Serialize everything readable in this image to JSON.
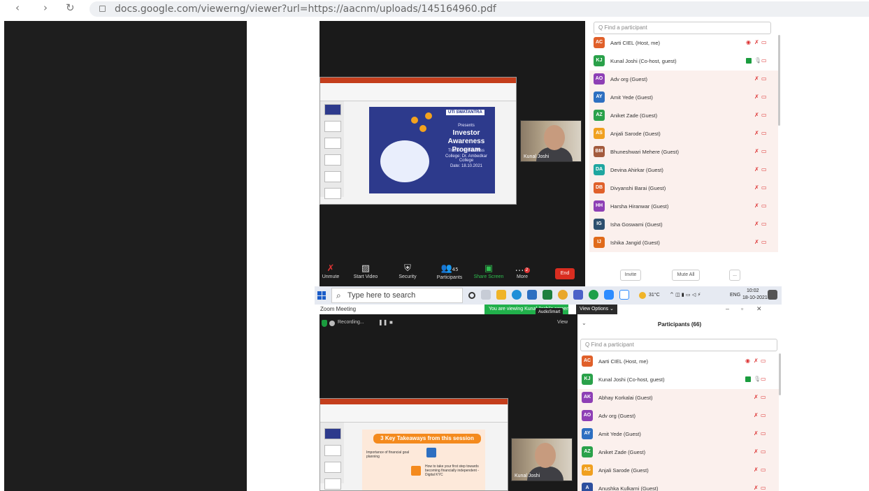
{
  "browser": {
    "url": "docs.google.com/viewerng/viewer?url=https://aacnm/uploads/145164960.pdf",
    "back_glyph": "‹",
    "forward_glyph": "›",
    "reload_glyph": "↻"
  },
  "meeting_top": {
    "slide": {
      "logo": "UTI SWATANTRA",
      "presents": "Presents",
      "title": "Investor Awareness Program",
      "trainer": "Trainer: by Ms/Miss",
      "college": "College: Dr. Ambedkar College",
      "date": "Date: 18.10.2021"
    },
    "camera_label": "Kunal Joshi"
  },
  "toolbar": {
    "unmute": "Unmute",
    "start_video": "Start Video",
    "security": "Security",
    "participants": "Participants",
    "participants_count": "45",
    "share_screen": "Share Screen",
    "more": "More",
    "end": "End",
    "more_badge": "2"
  },
  "participants_top": {
    "search_placeholder": "Find a participant",
    "items": [
      {
        "initials": "AC",
        "name": "Aarti CIEL (Host, me)",
        "color": "#e0602a"
      },
      {
        "initials": "KJ",
        "name": "Kunal Joshi (Co-host, guest)",
        "color": "#2aa14a"
      },
      {
        "initials": "AO",
        "name": "Adv org (Guest)",
        "color": "#8e3fb5"
      },
      {
        "initials": "AY",
        "name": "Amit Yede (Guest)",
        "color": "#2d6fc1"
      },
      {
        "initials": "AZ",
        "name": "Aniket Zade (Guest)",
        "color": "#2aa14a"
      },
      {
        "initials": "AS",
        "name": "Anjali Sarode (Guest)",
        "color": "#f0a020"
      },
      {
        "initials": "BM",
        "name": "Bhuneshwari Mehere (Guest)",
        "color": "#a35a3d"
      },
      {
        "initials": "DA",
        "name": "Devina Ahirkar (Guest)",
        "color": "#1fa6a0"
      },
      {
        "initials": "DB",
        "name": "Divyanshi Barai (Guest)",
        "color": "#e0602a"
      },
      {
        "initials": "HH",
        "name": "Harsha Hiranwar (Guest)",
        "color": "#8e3fb5"
      },
      {
        "initials": "IG",
        "name": "Isha Goswami (Guest)",
        "color": "#2d4f6e"
      },
      {
        "initials": "IJ",
        "name": "Ishika Jangid (Guest)",
        "color": "#e06a1a"
      }
    ],
    "invite": "Invite",
    "mute_all": "Mute All",
    "more": "..."
  },
  "taskbar": {
    "search_placeholder": "Type here to search",
    "temperature": "31°C",
    "language": "ENG",
    "time": "10:02",
    "date": "18-10-2021"
  },
  "meeting_bottom": {
    "window_title": "Zoom Meeting",
    "banner": "You are viewing Kunal Joshi's screen",
    "tooltip": "AudioSmart",
    "view_options": "View Options ⌄",
    "recording": "Recording...",
    "view": "View",
    "participants_header": "Participants (66)",
    "slide": {
      "heading": "3 Key Takeaways from this session",
      "point1": "Importance of financial goal planning",
      "point2": "How to take your first step towards becoming financially independent - Digital KYC"
    },
    "camera_label": "Kunal Joshi"
  },
  "participants_bottom": {
    "search_placeholder": "Find a participant",
    "items": [
      {
        "initials": "AC",
        "name": "Aarti CIEL (Host, me)",
        "color": "#e0602a"
      },
      {
        "initials": "KJ",
        "name": "Kunal Joshi (Co-host, guest)",
        "color": "#2aa14a"
      },
      {
        "initials": "AK",
        "name": "Abhay Korkalai (Guest)",
        "color": "#8e3fb5"
      },
      {
        "initials": "AO",
        "name": "Adv org (Guest)",
        "color": "#8e3fb5"
      },
      {
        "initials": "AY",
        "name": "Amit Yede (Guest)",
        "color": "#2d6fc1"
      },
      {
        "initials": "AZ",
        "name": "Aniket Zade (Guest)",
        "color": "#2aa14a"
      },
      {
        "initials": "AS",
        "name": "Anjali Sarode (Guest)",
        "color": "#f0a020"
      },
      {
        "initials": "A",
        "name": "Anushka Kulkarni (Guest)",
        "color": "#2d4f9e"
      }
    ]
  }
}
